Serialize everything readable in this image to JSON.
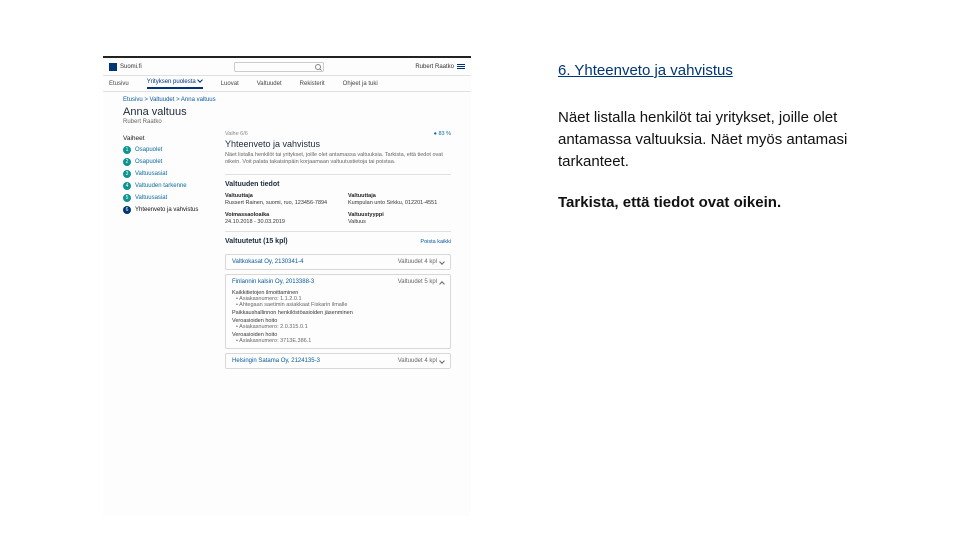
{
  "right": {
    "title": "6. Yhteenveto ja vahvistus",
    "body": "Näet listalla henkilöt tai yritykset, joille olet antamassa valtuuksia. Näet myös antamasi tarkanteet.",
    "bold": "Tarkista, että tiedot ovat oikein."
  },
  "mock": {
    "brand": "Suomi.fi",
    "user": "Rubert Raatko",
    "nav": {
      "n1": "Etusivu",
      "n2": "Yrityksen puolesta",
      "n3": "Luovat",
      "n4": "Valtuudet",
      "n5": "Rekisterit",
      "n6": "Ohjeet ja tuki"
    },
    "breadcrumb": "Etusivu > Valtuudet > Anna valtuus",
    "h1": "Anna valtuus",
    "sub": "Rubert Raatko",
    "side": {
      "head": "Vaiheet",
      "s1": "Osapuolet",
      "s2": "Osapuolet",
      "s3": "Valtuusasiat",
      "s4": "Valtuuden tarkenne",
      "s5": "Valtuusasiat",
      "s6": "Yhteenveto ja vahvistus"
    },
    "stephead": {
      "step": "Vaihe 6/6",
      "pct": "83 %"
    },
    "h2": "Yhteenveto ja vahvistus",
    "p": "Näet listalla henkilöt tai yritykset, joille olet antamassa valtuuksia. Tarkista, että tiedot ovat oikein. Voit palata takaisinpäin korjaamaan valtuutustietoja tai poistaa.",
    "sec1": {
      "title": "Valtuuden tiedot",
      "l1": "Valtuuttaja",
      "v1": "Russert Rainen, suomi, ruo, 123456-7894",
      "l2": "Valtuuttaja",
      "v2": "Kumpulan unto Sirkku, 012201-4551",
      "l3": "Voimassaoloaika",
      "v3": "24.10.2018 - 30.03.2019",
      "l4": "Valtuustyyppi",
      "v4": "Valtuus"
    },
    "listhead": {
      "title": "Valtuutetut (15 kpl)",
      "remove": "Poista kaikki"
    },
    "rows": {
      "r1": {
        "name": "Valtkokasat Oy, 2130341-4",
        "badge": "Valtuudet 4 kpl"
      },
      "r2": {
        "name": "Finlannin kalsin Oy, 2013388-3",
        "badge": "Valtuudet 5 kpl",
        "p1": "Kaikkitietojen ilmoittaminen",
        "d1a": "Asiakasnumero: 1.1.2.0.1",
        "d1b": "Ahtegaan saetimin asiakkaat Fiskarin ilmalle",
        "p2": "Paikkaushallinnon henkilöstöasioiden jäsenminen",
        "p3": "Veroasioiden hoito",
        "d3": "Asiakasnumero: 2.0.315.0.1",
        "p4": "Veroasioiden hoito",
        "d4": "Asiakasnumero: 3713E.386.1"
      },
      "r3": {
        "name": "Helsingin Satama Oy, 2124135-3",
        "badge": "Valtuudet 4 kpl"
      }
    }
  }
}
